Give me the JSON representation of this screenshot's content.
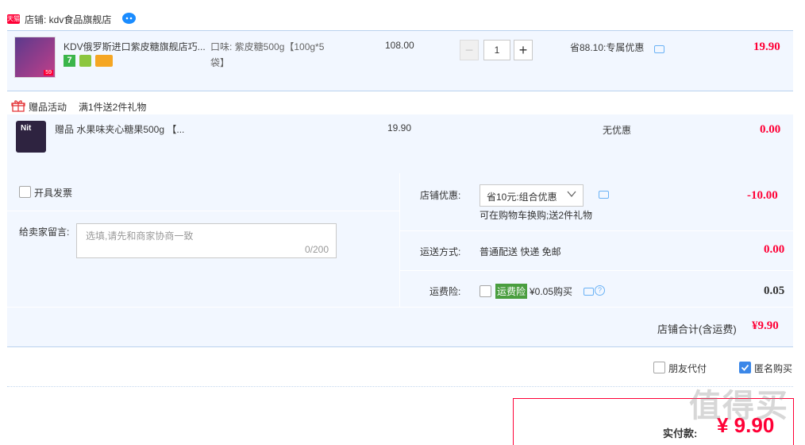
{
  "shop": {
    "badge": "天猫",
    "label": "店铺: kdv食品旗舰店"
  },
  "item": {
    "title": "KDV俄罗斯进口紫皮糖旗舰店巧...",
    "sku_line1": "口味: 紫皮糖500g【100g*5",
    "sku_line2": "袋】",
    "price": "108.00",
    "quantity": "1",
    "minus": "−",
    "plus": "+",
    "promo": "省88.10:专属优惠",
    "subtotal": "19.90",
    "tag7": "7"
  },
  "gift": {
    "header": "赠品活动",
    "rule": "满1件送2件礼物",
    "name": "赠品 水果味夹心糖果500g 【...",
    "price": "19.90",
    "promo": "无优惠",
    "subtotal": "0.00"
  },
  "invoice": {
    "label": "开具发票"
  },
  "message": {
    "label": "给卖家留言:",
    "placeholder": "选填,请先和商家协商一致",
    "counter": "0/200"
  },
  "shop_discount": {
    "label": "店铺优惠:",
    "selected": "省10元:组合优惠",
    "note": "可在购物车换购;送2件礼物",
    "amount": "-10.00"
  },
  "shipping": {
    "label": "运送方式:",
    "value": "普通配送 快递 免邮",
    "amount": "0.00"
  },
  "insurance": {
    "label": "运费险:",
    "tag": "运费险",
    "price": "¥0.05购买",
    "amount": "0.05"
  },
  "total": {
    "label": "店铺合计(含运费)",
    "amount": "¥9.90"
  },
  "options": {
    "friend_pay": "朋友代付",
    "anonymous": "匿名购买"
  },
  "actual_pay": {
    "label": "实付款:",
    "amount": "¥ 9.90"
  },
  "watermark": {
    "text": "值得买"
  },
  "colors": {
    "accent": "#ff0036",
    "panel": "#f2f7ff",
    "border": "#b9d2ee",
    "brand_blue": "#3b87e8"
  }
}
